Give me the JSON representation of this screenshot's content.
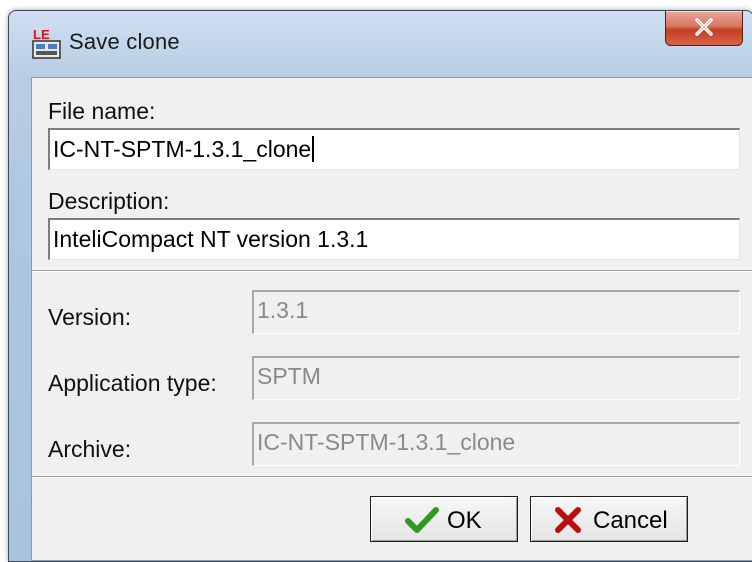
{
  "window": {
    "title": "Save clone",
    "app_icon_text": "LE",
    "close_label": "X"
  },
  "form": {
    "file_name_label": "File name:",
    "file_name_value": "IC-NT-SPTM-1.3.1_clone",
    "description_label": "Description:",
    "description_value": "InteliCompact NT version 1.3.1",
    "version_label": "Version:",
    "version_value": "1.3.1",
    "app_type_label": "Application type:",
    "app_type_value": "SPTM",
    "archive_label": "Archive:",
    "archive_value": "IC-NT-SPTM-1.3.1_clone"
  },
  "buttons": {
    "ok_label": "OK",
    "ok_icon": "checkmark-icon",
    "cancel_label": "Cancel",
    "cancel_icon": "cross-icon"
  },
  "colors": {
    "close_button": "#c94a30",
    "ok_check": "#2f9a1e",
    "cancel_x": "#b81010"
  }
}
